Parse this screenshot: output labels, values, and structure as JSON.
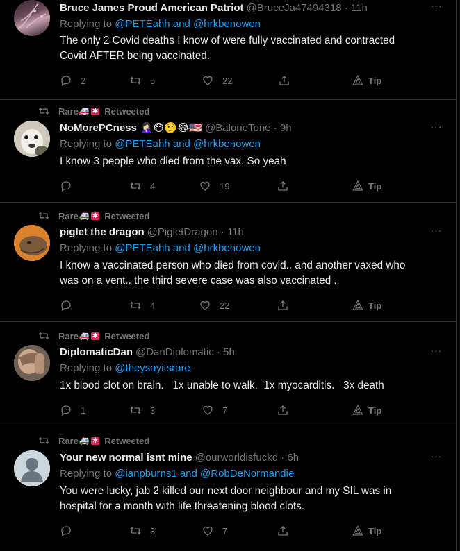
{
  "colors": {
    "accent": "#1d9bf0",
    "muted": "#71767b",
    "text": "#e7e9ea",
    "border": "#2f3336",
    "background": "#000000"
  },
  "tweets": [
    {
      "retweeted_by": "",
      "name": "Bruce James Proud American Patriot",
      "name_suffix": "",
      "handle_time": "@BruceJa47494318 · 11h",
      "replying_prefix": "Replying to ",
      "mentions": "@PETEahh and @hrkbenowen",
      "text_lines": [
        "The only 2 Covid deaths I know of were fully vaccinated and contracted",
        "Covid AFTER being vaccinated."
      ],
      "replies": "2",
      "retweets": "5",
      "likes": "22",
      "tip": "Tip"
    },
    {
      "retweeted_by": "Rare",
      "retweet_label": "Retweeted",
      "name": "NoMorePCness",
      "name_suffix": "🤦🏻‍♀️😷🤥😂🇺🇸",
      "handle_time": "@BaloneTone · 9h",
      "replying_prefix": "Replying to ",
      "mentions": "@PETEahh and @hrkbenowen",
      "text_lines": [
        "I know 3 people who died from the vax. So yeah"
      ],
      "replies": "",
      "retweets": "4",
      "likes": "19",
      "tip": "Tip"
    },
    {
      "retweeted_by": "Rare",
      "retweet_label": "Retweeted",
      "name": "piglet the dragon",
      "name_suffix": "",
      "handle_time": "@PigletDragon · 11h",
      "replying_prefix": "Replying to ",
      "mentions": "@PETEahh and @hrkbenowen",
      "text_lines": [
        "I know a vaccinated person who died from covid.. and another vaxed who",
        "was on a vent.. the third severe case was also vaccinated ."
      ],
      "replies": "",
      "retweets": "4",
      "likes": "22",
      "tip": "Tip"
    },
    {
      "retweeted_by": "Rare",
      "retweet_label": "Retweeted",
      "name": "DiplomaticDan",
      "name_suffix": "",
      "handle_time": "@DanDiplomatic · 5h",
      "replying_prefix": "Replying to ",
      "mentions": "@theysayitsrare",
      "text_lines": [
        "1x blood clot on brain.   1x unable to walk.  1x myocarditis.   3x death"
      ],
      "replies": "1",
      "retweets": "3",
      "likes": "7",
      "tip": "Tip"
    },
    {
      "retweeted_by": "Rare",
      "retweet_label": "Retweeted",
      "name": "Your new normal isnt mine",
      "name_suffix": "",
      "handle_time": "@ourworldisfuckd · 6h",
      "replying_prefix": "Replying to ",
      "mentions": "@ianpburns1 and @RobDeNormandie",
      "text_lines": [
        "You were lucky, jab 2 killed our next door neighbour and my SIL was in",
        "hospital for a month with life threatening blood clots."
      ],
      "replies": "",
      "retweets": "3",
      "likes": "7",
      "tip": "Tip"
    }
  ]
}
